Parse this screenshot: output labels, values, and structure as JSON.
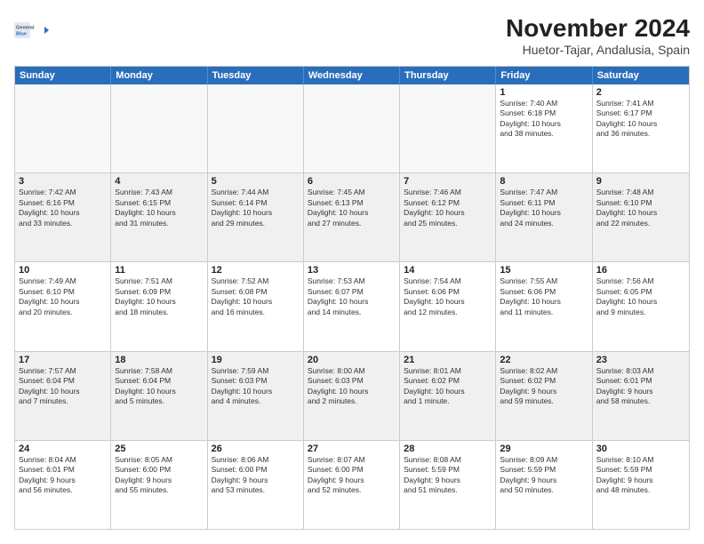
{
  "logo": {
    "general": "General",
    "blue": "Blue"
  },
  "title": "November 2024",
  "subtitle": "Huetor-Tajar, Andalusia, Spain",
  "weekdays": [
    "Sunday",
    "Monday",
    "Tuesday",
    "Wednesday",
    "Thursday",
    "Friday",
    "Saturday"
  ],
  "weeks": [
    [
      {
        "day": "",
        "info": "",
        "empty": true
      },
      {
        "day": "",
        "info": "",
        "empty": true
      },
      {
        "day": "",
        "info": "",
        "empty": true
      },
      {
        "day": "",
        "info": "",
        "empty": true
      },
      {
        "day": "",
        "info": "",
        "empty": true
      },
      {
        "day": "1",
        "info": "Sunrise: 7:40 AM\nSunset: 6:18 PM\nDaylight: 10 hours\nand 38 minutes."
      },
      {
        "day": "2",
        "info": "Sunrise: 7:41 AM\nSunset: 6:17 PM\nDaylight: 10 hours\nand 36 minutes."
      }
    ],
    [
      {
        "day": "3",
        "info": "Sunrise: 7:42 AM\nSunset: 6:16 PM\nDaylight: 10 hours\nand 33 minutes."
      },
      {
        "day": "4",
        "info": "Sunrise: 7:43 AM\nSunset: 6:15 PM\nDaylight: 10 hours\nand 31 minutes."
      },
      {
        "day": "5",
        "info": "Sunrise: 7:44 AM\nSunset: 6:14 PM\nDaylight: 10 hours\nand 29 minutes."
      },
      {
        "day": "6",
        "info": "Sunrise: 7:45 AM\nSunset: 6:13 PM\nDaylight: 10 hours\nand 27 minutes."
      },
      {
        "day": "7",
        "info": "Sunrise: 7:46 AM\nSunset: 6:12 PM\nDaylight: 10 hours\nand 25 minutes."
      },
      {
        "day": "8",
        "info": "Sunrise: 7:47 AM\nSunset: 6:11 PM\nDaylight: 10 hours\nand 24 minutes."
      },
      {
        "day": "9",
        "info": "Sunrise: 7:48 AM\nSunset: 6:10 PM\nDaylight: 10 hours\nand 22 minutes."
      }
    ],
    [
      {
        "day": "10",
        "info": "Sunrise: 7:49 AM\nSunset: 6:10 PM\nDaylight: 10 hours\nand 20 minutes."
      },
      {
        "day": "11",
        "info": "Sunrise: 7:51 AM\nSunset: 6:09 PM\nDaylight: 10 hours\nand 18 minutes."
      },
      {
        "day": "12",
        "info": "Sunrise: 7:52 AM\nSunset: 6:08 PM\nDaylight: 10 hours\nand 16 minutes."
      },
      {
        "day": "13",
        "info": "Sunrise: 7:53 AM\nSunset: 6:07 PM\nDaylight: 10 hours\nand 14 minutes."
      },
      {
        "day": "14",
        "info": "Sunrise: 7:54 AM\nSunset: 6:06 PM\nDaylight: 10 hours\nand 12 minutes."
      },
      {
        "day": "15",
        "info": "Sunrise: 7:55 AM\nSunset: 6:06 PM\nDaylight: 10 hours\nand 11 minutes."
      },
      {
        "day": "16",
        "info": "Sunrise: 7:56 AM\nSunset: 6:05 PM\nDaylight: 10 hours\nand 9 minutes."
      }
    ],
    [
      {
        "day": "17",
        "info": "Sunrise: 7:57 AM\nSunset: 6:04 PM\nDaylight: 10 hours\nand 7 minutes."
      },
      {
        "day": "18",
        "info": "Sunrise: 7:58 AM\nSunset: 6:04 PM\nDaylight: 10 hours\nand 5 minutes."
      },
      {
        "day": "19",
        "info": "Sunrise: 7:59 AM\nSunset: 6:03 PM\nDaylight: 10 hours\nand 4 minutes."
      },
      {
        "day": "20",
        "info": "Sunrise: 8:00 AM\nSunset: 6:03 PM\nDaylight: 10 hours\nand 2 minutes."
      },
      {
        "day": "21",
        "info": "Sunrise: 8:01 AM\nSunset: 6:02 PM\nDaylight: 10 hours\nand 1 minute."
      },
      {
        "day": "22",
        "info": "Sunrise: 8:02 AM\nSunset: 6:02 PM\nDaylight: 9 hours\nand 59 minutes."
      },
      {
        "day": "23",
        "info": "Sunrise: 8:03 AM\nSunset: 6:01 PM\nDaylight: 9 hours\nand 58 minutes."
      }
    ],
    [
      {
        "day": "24",
        "info": "Sunrise: 8:04 AM\nSunset: 6:01 PM\nDaylight: 9 hours\nand 56 minutes."
      },
      {
        "day": "25",
        "info": "Sunrise: 8:05 AM\nSunset: 6:00 PM\nDaylight: 9 hours\nand 55 minutes."
      },
      {
        "day": "26",
        "info": "Sunrise: 8:06 AM\nSunset: 6:00 PM\nDaylight: 9 hours\nand 53 minutes."
      },
      {
        "day": "27",
        "info": "Sunrise: 8:07 AM\nSunset: 6:00 PM\nDaylight: 9 hours\nand 52 minutes."
      },
      {
        "day": "28",
        "info": "Sunrise: 8:08 AM\nSunset: 5:59 PM\nDaylight: 9 hours\nand 51 minutes."
      },
      {
        "day": "29",
        "info": "Sunrise: 8:09 AM\nSunset: 5:59 PM\nDaylight: 9 hours\nand 50 minutes."
      },
      {
        "day": "30",
        "info": "Sunrise: 8:10 AM\nSunset: 5:59 PM\nDaylight: 9 hours\nand 48 minutes."
      }
    ]
  ]
}
